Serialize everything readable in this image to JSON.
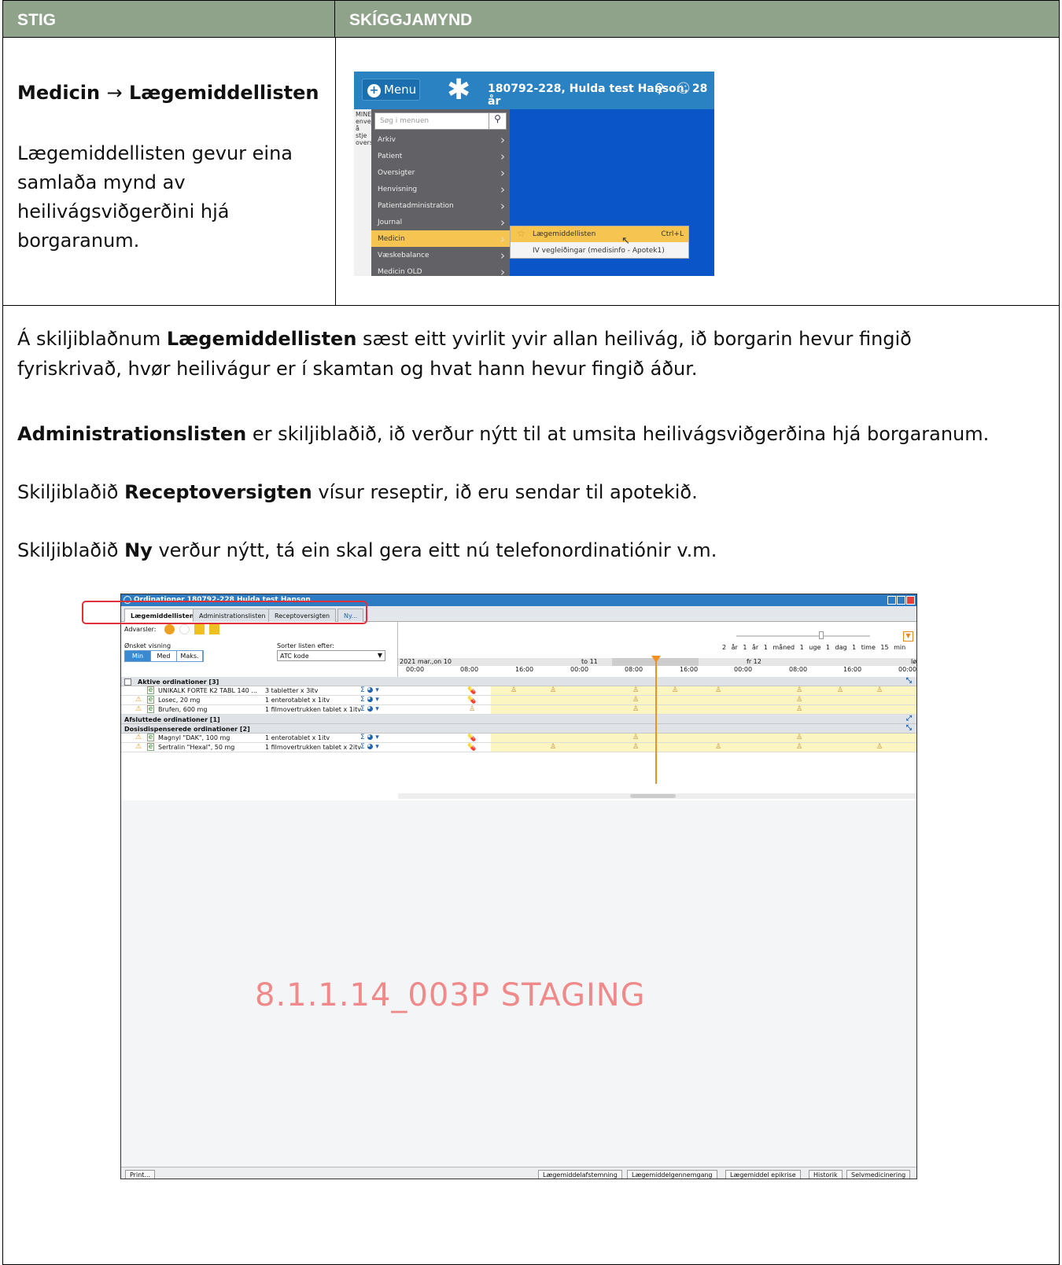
{
  "table": {
    "col1_header": "STIG",
    "col2_header": "SKÍGGJAMYND",
    "step_title_a": "Medicin",
    "step_title_arrow": "→",
    "step_title_b": "Lægemiddellisten",
    "step_desc": "Lægemiddellisten gevur eina samlaða mynd av heilivágsviðgerðini hjá borgaranum."
  },
  "menu_shot": {
    "menu_label": "Menu",
    "patient_info": "180792-228, Hulda test Hanson, 28 år",
    "search_placeholder": "Søg i menuen",
    "side_text": "MINE envej å stje overs",
    "items": [
      "Arkiv",
      "Patient",
      "Oversigter",
      "Henvisning",
      "Patientadministration",
      "Journal",
      "Medicin",
      "Væskebalance",
      "Medicin OLD"
    ],
    "submenu": [
      {
        "label": "Lægemiddellisten",
        "shortcut": "Ctrl+L"
      },
      {
        "label": "IV vegleiðingar (medisinfo - Apotek1)",
        "shortcut": ""
      }
    ]
  },
  "paragraphs": {
    "p1_a": "Á skiljiblaðnum ",
    "p1_b": "Lægemiddellisten",
    "p1_c": " sæst eitt yvirlit yvir allan heilivág, ið borgarin hevur fingið",
    "p1_d": "fyriskrivað, hvør heilivágur er í skamtan og hvat hann hevur fingið áður.",
    "p2_b": "Administrationslisten",
    "p2_c": " er skiljiblaðið, ið verður nýtt til at umsita heilivágsviðgerðina hjá borgaranum.",
    "p3_a": "Skiljiblaðið ",
    "p3_b": "Receptoversigten",
    "p3_c": " vísur reseptir, ið eru sendar til apotekið.",
    "p4_a": "Skiljiblaðið ",
    "p4_b": "Ny",
    "p4_c": " verður nýtt, tá ein skal gera eitt nú telefonordinatiónir v.m."
  },
  "app": {
    "title": "Ordinationer 180792-228 Hulda test Hanson",
    "tabs": [
      "Lægemiddellisten",
      "Administrationslisten",
      "Receptoversigten",
      "Ny..."
    ],
    "advarsler_label": "Advarsler:",
    "view_label": "Ønsket visning",
    "view_options": [
      "Min",
      "Med",
      "Maks."
    ],
    "sort_label": "Sorter listen efter:",
    "sort_value": "ATC kode",
    "zoom_labels": "2 år 1 år 1 måned 1 uge 1 dag 1 time 15 min",
    "days": [
      "2021 mar.,on 10",
      "to 11",
      "fr 12",
      "lø"
    ],
    "hours": [
      "00:00",
      "08:00",
      "16:00",
      "00:00",
      "08:00",
      "16:00",
      "00:00",
      "08:00",
      "16:00",
      "00:00"
    ],
    "sections": {
      "active": "Aktive ordinationer [3]",
      "closed": "Afsluttede ordinationer [1]",
      "dose": "Dosisdispenserede ordinationer [2]"
    },
    "active_rows": [
      {
        "name": "UNIKALK FORTE K2 TABL 140 ...",
        "dose": "3 tabletter x 3itv"
      },
      {
        "name": "Losec, 20 mg",
        "dose": "1 enterotablet x 1itv"
      },
      {
        "name": "Brufen, 600 mg",
        "dose": "1 filmovertrukken tablet x 1itv"
      }
    ],
    "dose_rows": [
      {
        "name": "Magnyl \"DAK\", 100 mg",
        "dose": "1 enterotablet x 1itv"
      },
      {
        "name": "Sertralin \"Hexal\", 50 mg",
        "dose": "1 filmovertrukken tablet x 2itv"
      }
    ],
    "watermark": "8.1.1.14_003P STAGING",
    "footer_left": "Print...",
    "footer_buttons": [
      "Lægemiddelafstemning",
      "Lægemiddelgennemgang",
      "Lægemiddel epikrise",
      "Historik",
      "Selvmedicinering"
    ]
  },
  "colors": {
    "header_bg": "#8fa38a",
    "highlight": "#e0303a",
    "accent": "#2d7bc2"
  }
}
